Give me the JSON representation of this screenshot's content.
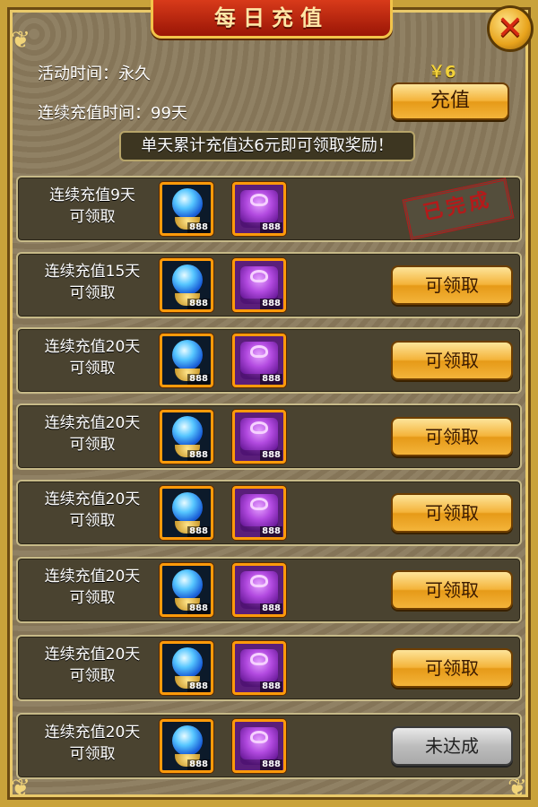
{
  "title": "每日充值",
  "close_icon": "close-icon",
  "activity_time_label": "活动时间：永久",
  "consecutive_time_label": "连续充值时间：99天",
  "price": "￥6",
  "recharge_button": "充值",
  "notice": "单天累计充值达6元即可领取奖励！",
  "rewards": [
    {
      "title": "连续充值9天",
      "subtitle": "可领取",
      "item1_count": "888",
      "item2_count": "888",
      "status": "已完成",
      "state": "done"
    },
    {
      "title": "连续充值15天",
      "subtitle": "可领取",
      "item1_count": "888",
      "item2_count": "888",
      "status": "可领取",
      "state": "claim"
    },
    {
      "title": "连续充值20天",
      "subtitle": "可领取",
      "item1_count": "888",
      "item2_count": "888",
      "status": "可领取",
      "state": "claim"
    },
    {
      "title": "连续充值20天",
      "subtitle": "可领取",
      "item1_count": "888",
      "item2_count": "888",
      "status": "可领取",
      "state": "claim"
    },
    {
      "title": "连续充值20天",
      "subtitle": "可领取",
      "item1_count": "888",
      "item2_count": "888",
      "status": "可领取",
      "state": "claim"
    },
    {
      "title": "连续充值20天",
      "subtitle": "可领取",
      "item1_count": "888",
      "item2_count": "888",
      "status": "可领取",
      "state": "claim"
    },
    {
      "title": "连续充值20天",
      "subtitle": "可领取",
      "item1_count": "888",
      "item2_count": "888",
      "status": "可领取",
      "state": "claim"
    },
    {
      "title": "连续充值20天",
      "subtitle": "可领取",
      "item1_count": "888",
      "item2_count": "888",
      "status": "未达成",
      "state": "locked"
    }
  ],
  "colors": {
    "gold": "#f4b33a",
    "panel": "#8a7a5c",
    "title_red": "#c42a10",
    "stamp_red": "#b41a1a"
  }
}
